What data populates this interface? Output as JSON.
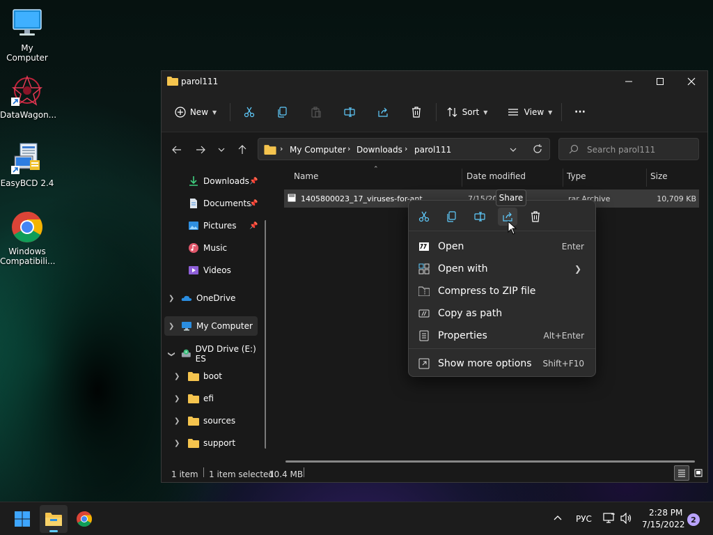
{
  "desktop": {
    "icons": [
      {
        "label": "My Computer"
      },
      {
        "label": "DataWagon..."
      },
      {
        "label": "EasyBCD 2.4"
      },
      {
        "label": "Windows Compatibili..."
      }
    ]
  },
  "window": {
    "title": "parol111",
    "toolbar": {
      "new_label": "New",
      "sort_label": "Sort",
      "view_label": "View",
      "more_label": "···"
    },
    "address": {
      "crumbs": [
        "My Computer",
        "Downloads",
        "parol111"
      ]
    },
    "search": {
      "placeholder": "Search parol111"
    },
    "sidebar": {
      "quick": [
        {
          "label": "Downloads"
        },
        {
          "label": "Documents"
        },
        {
          "label": "Pictures"
        },
        {
          "label": "Music"
        },
        {
          "label": "Videos"
        }
      ],
      "onedrive": "OneDrive",
      "mycomputer": "My Computer",
      "dvd": "DVD Drive (E:) ES",
      "folders": [
        {
          "label": "boot"
        },
        {
          "label": "efi"
        },
        {
          "label": "sources"
        },
        {
          "label": "support"
        }
      ]
    },
    "columns": {
      "name": "Name",
      "date": "Date modified",
      "type": "Type",
      "size": "Size"
    },
    "files": [
      {
        "name": "1405800023_17_viruses-for-ant.rar",
        "date": "7/15/20",
        "type": "rar Archive",
        "size": "10,709 KB"
      }
    ],
    "status": {
      "items": "1 item",
      "selected": "1 item selected",
      "size": "10.4 MB"
    }
  },
  "context_menu": {
    "tooltip": "Share",
    "items": [
      {
        "label": "Open",
        "shortcut": "Enter"
      },
      {
        "label": "Open with",
        "shortcut": ""
      },
      {
        "label": "Compress to ZIP file",
        "shortcut": ""
      },
      {
        "label": "Copy as path",
        "shortcut": ""
      },
      {
        "label": "Properties",
        "shortcut": "Alt+Enter"
      },
      {
        "label": "Show more options",
        "shortcut": "Shift+F10"
      }
    ]
  },
  "taskbar": {
    "lang": "РУС",
    "time": "2:28 PM",
    "date": "7/15/2022",
    "notif_count": "2"
  },
  "colors": {
    "accent": "#60cdff",
    "folder": "#f5c44e"
  }
}
